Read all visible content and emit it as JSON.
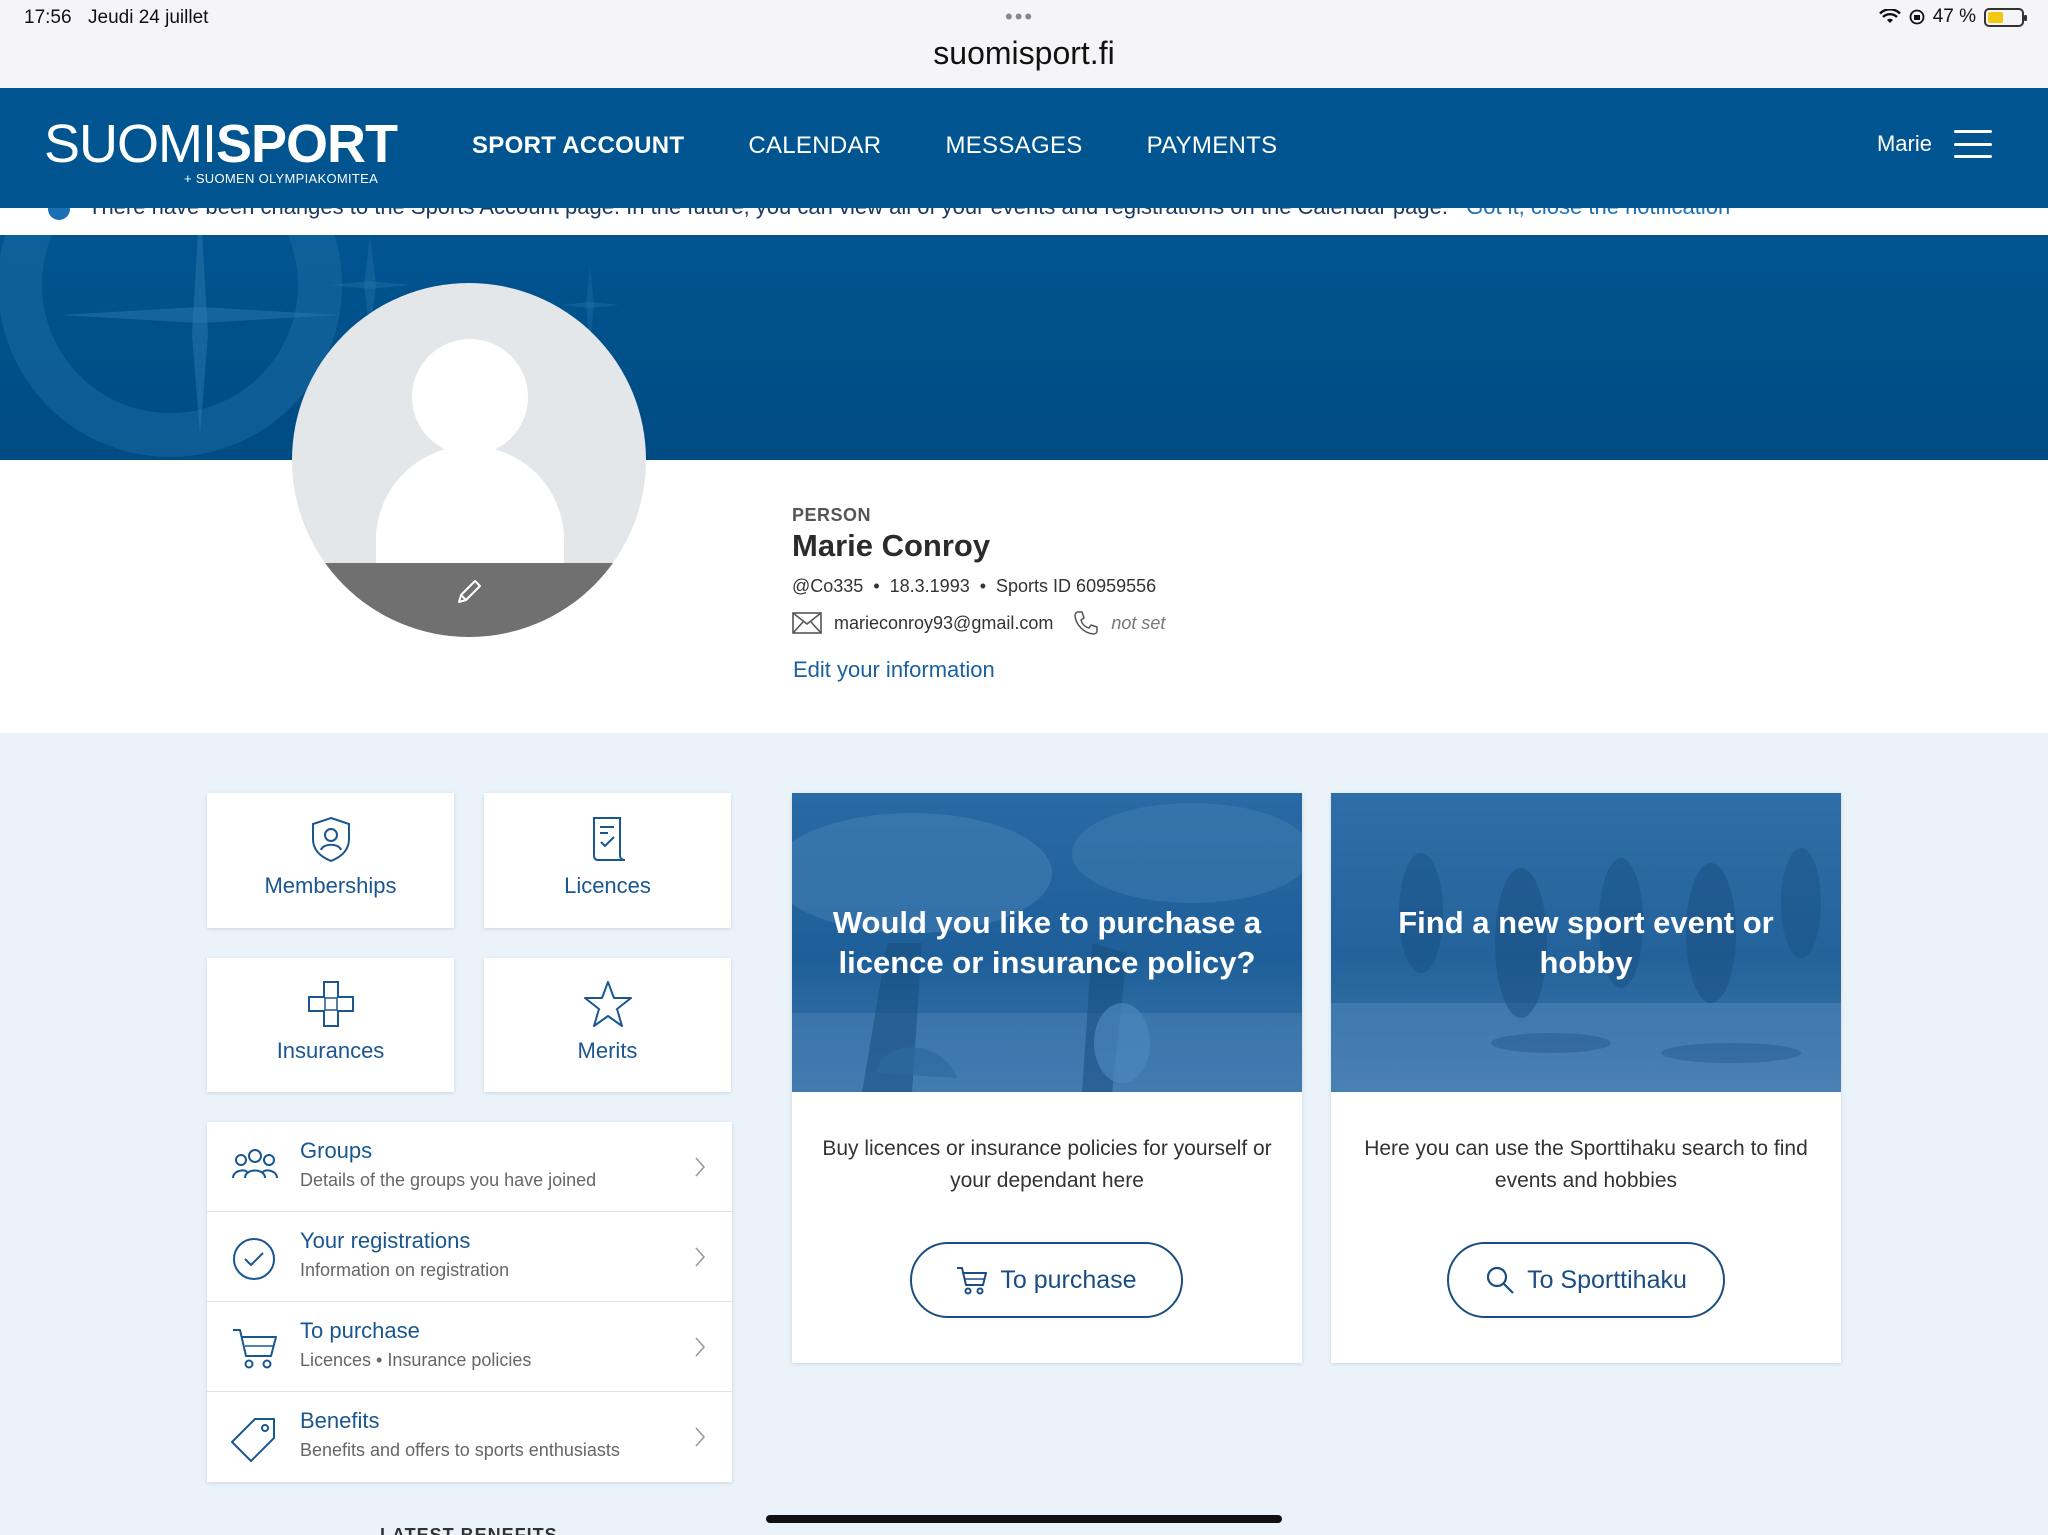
{
  "status_bar": {
    "time": "17:56",
    "date": "Jeudi 24 juillet",
    "battery": "47 %",
    "battery_level": 0.47
  },
  "browser": {
    "url": "suomisport.fi"
  },
  "header": {
    "logo_light": "SUOMI",
    "logo_bold": "SPORT",
    "logo_sub": "SUOMEN OLYMPIAKOMITEA",
    "nav": [
      "SPORT ACCOUNT",
      "CALENDAR",
      "MESSAGES",
      "PAYMENTS"
    ],
    "user": "Marie"
  },
  "notice": {
    "text": "There have been changes to the Sports Account page. In the future, you can view all of your events and registrations on the Calendar page.",
    "link": "Got it, close the notification"
  },
  "profile": {
    "label": "PERSON",
    "name": "Marie Conroy",
    "handle": "@Co335",
    "birthdate": "18.3.1993",
    "sports_id": "Sports ID 60959556",
    "email": "marieconroy93@gmail.com",
    "phone": "not set",
    "edit_link": "Edit your information"
  },
  "tiles": {
    "memberships": "Memberships",
    "licences": "Licences",
    "insurances": "Insurances",
    "merits": "Merits"
  },
  "list": [
    {
      "title": "Groups",
      "subtitle": "Details of the groups you have joined"
    },
    {
      "title": "Your registrations",
      "subtitle": "Information on registration"
    },
    {
      "title": "To purchase",
      "subtitle": "Licences • Insurance policies"
    },
    {
      "title": "Benefits",
      "subtitle": "Benefits and offers to sports enthusiasts"
    }
  ],
  "cards": {
    "purchase": {
      "title": "Would you like to purchase a licence or insurance policy?",
      "description": "Buy licences or insurance policies for yourself or your dependant here",
      "button": "To purchase"
    },
    "search": {
      "title": "Find a new sport event or hobby",
      "description": "Here you can use the Sporttihaku search to find events and hobbies",
      "button": "To Sporttihaku"
    }
  },
  "footer": {
    "latest": "LATEST BENEFITS"
  },
  "colors": {
    "brand": "#005591",
    "link": "#1a5690",
    "background": "#eaf3fa"
  }
}
